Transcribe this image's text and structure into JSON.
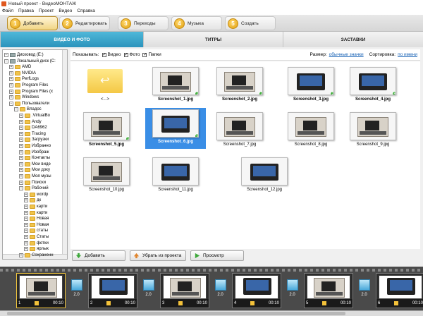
{
  "window": {
    "title": "Новый проект - ВидеоМОНТАЖ"
  },
  "menu": [
    "Файл",
    "Правка",
    "Проект",
    "Видео",
    "Справка"
  ],
  "steps": [
    {
      "num": "1",
      "label": "Добавить"
    },
    {
      "num": "2",
      "label": "Редактировать"
    },
    {
      "num": "3",
      "label": "Переходы"
    },
    {
      "num": "4",
      "label": "Музыка"
    },
    {
      "num": "5",
      "label": "Создать"
    }
  ],
  "tabs": [
    "ВИДЕО И ФОТО",
    "ТИТРЫ",
    "ЗАСТАВКИ"
  ],
  "tree": [
    "Дисковод (E:)",
    "Локальный диск (C:",
    "AMD",
    "NVIDIA",
    "PerfLogs",
    "Program Files",
    "Program Files (x",
    "Windows",
    "Пользователи",
    "Владос",
    ".VirtualBo",
    "Andy",
    "DA6962",
    "Tracing",
    "Загрузки",
    "Избранно",
    "Изображ",
    "Контакты",
    "Мои виде",
    "Мои доку",
    "Моя музы",
    "Поиски",
    "Рабочий",
    "wordp",
    "дк",
    "карти",
    "карти",
    "Новая",
    "Новая",
    "статы",
    "Статы",
    "фотки",
    "ярлык",
    "Сохраненн"
  ],
  "filter": {
    "show_label": "Показывать:",
    "video": "Видео",
    "photo": "Фото",
    "folders": "Папки",
    "size_label": "Размер:",
    "size_value": "обычные значки",
    "sort_label": "Сортировка:",
    "sort_value": "по имени"
  },
  "files": [
    {
      "name": "<...>",
      "kind": "up"
    },
    {
      "name": "Screenshot_1.jpg",
      "kind": "pc"
    },
    {
      "name": "Screenshot_2.jpg",
      "kind": "pc"
    },
    {
      "name": "Screenshot_3.jpg",
      "kind": "laptop"
    },
    {
      "name": "Screenshot_4.jpg",
      "kind": "laptop"
    },
    {
      "name": "Screenshot_5.jpg",
      "kind": "pc"
    },
    {
      "name": "Screenshot_6.jpg",
      "kind": "laptop"
    },
    {
      "name": "Screenshot_7.jpg",
      "kind": "pc"
    },
    {
      "name": "Screenshot_8.jpg",
      "kind": "pc"
    },
    {
      "name": "Screenshot_9.jpg",
      "kind": "pc"
    },
    {
      "name": "Screenshot_10.jpg",
      "kind": "pc"
    },
    {
      "name": "Screenshot_11.jpg",
      "kind": "laptop"
    },
    {
      "name": "Screenshot_12.jpg",
      "kind": "laptop"
    }
  ],
  "actions": {
    "add": "Добавить",
    "remove": "Убрать из проекта",
    "preview": "Просмотр"
  },
  "timeline": {
    "slots": [
      {
        "num": "1",
        "duration": "00:10"
      },
      {
        "num": "2",
        "duration": "00:10"
      },
      {
        "num": "3",
        "duration": "00:10"
      },
      {
        "num": "4",
        "duration": "00:10"
      },
      {
        "num": "5",
        "duration": "00:10"
      },
      {
        "num": "6",
        "duration": "00:10"
      }
    ],
    "transition_value": "2.0"
  }
}
